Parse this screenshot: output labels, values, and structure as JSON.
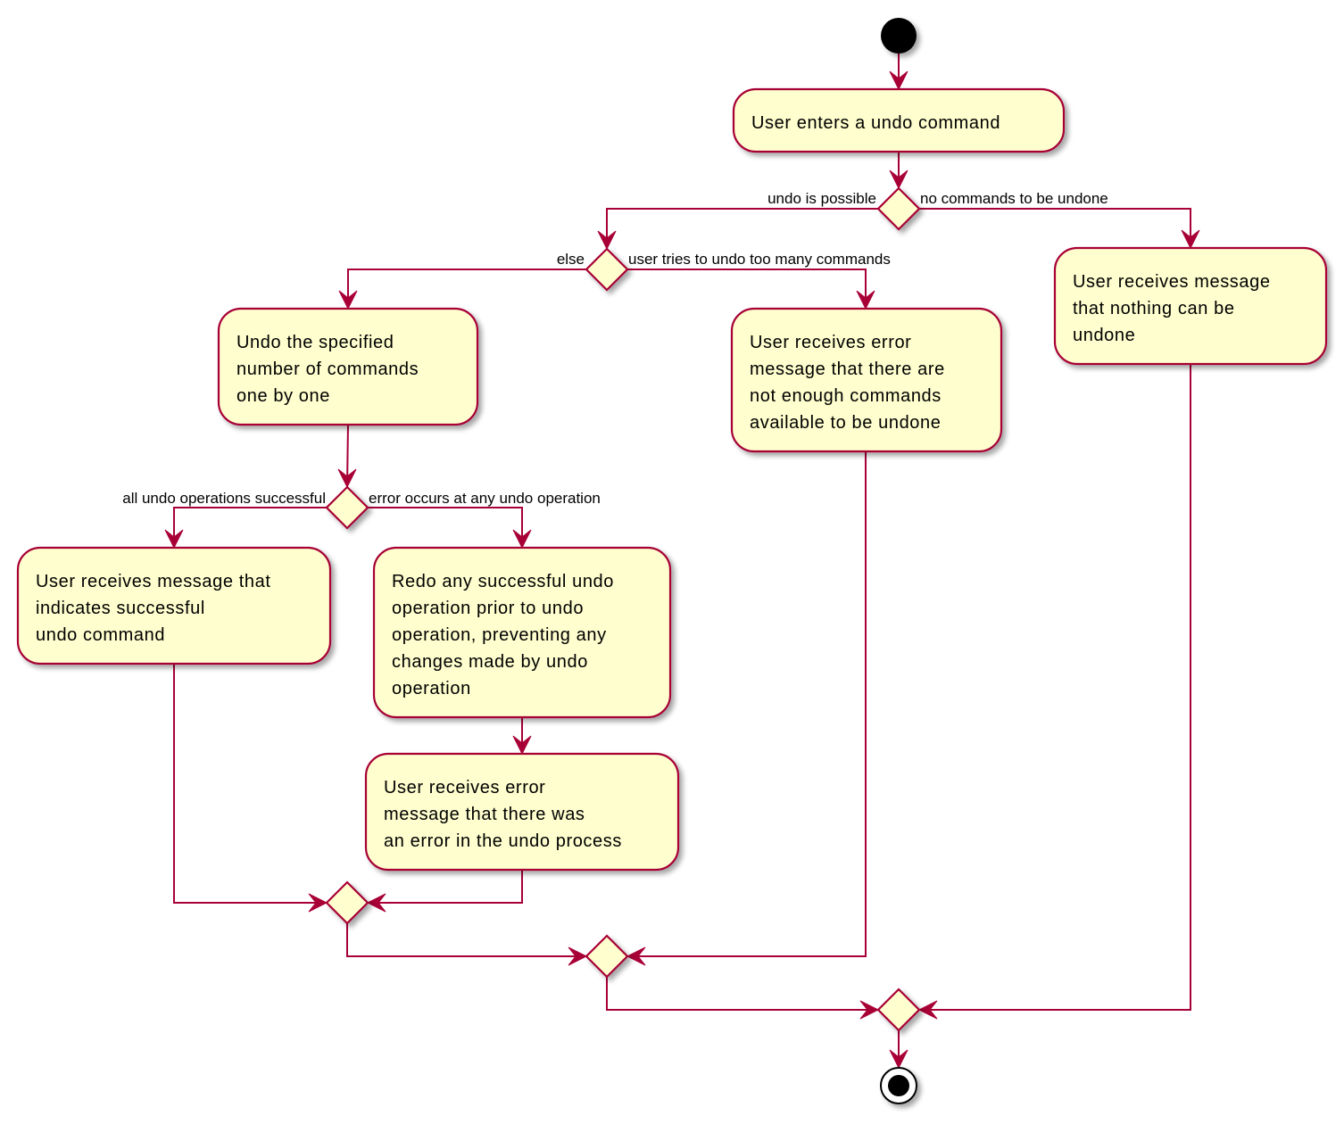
{
  "diagram": {
    "type": "UML activity diagram",
    "colors": {
      "line": "#A80036",
      "fill": "#FEFECE",
      "start": "#000000"
    },
    "nodes": {
      "start": {
        "kind": "start"
      },
      "enter_undo": {
        "kind": "activity",
        "lines": [
          "User enters a undo command"
        ]
      },
      "d_possible": {
        "kind": "decision"
      },
      "d_too_many": {
        "kind": "decision"
      },
      "undo_specified": {
        "kind": "activity",
        "lines": [
          "Undo the specified",
          "number of commands",
          "one by one"
        ]
      },
      "not_enough": {
        "kind": "activity",
        "lines": [
          "User receives error",
          "message that there are",
          "not enough commands",
          "available to be undone"
        ]
      },
      "nothing_undone": {
        "kind": "activity",
        "lines": [
          "User receives message",
          "that nothing can be",
          "undone"
        ]
      },
      "d_success": {
        "kind": "decision"
      },
      "msg_success": {
        "kind": "activity",
        "lines": [
          "User receives message that",
          "indicates successful",
          "undo command"
        ]
      },
      "redo": {
        "kind": "activity",
        "lines": [
          "Redo any successful undo",
          "operation prior to undo",
          "operation, preventing any",
          "changes made by undo",
          "operation"
        ]
      },
      "msg_error": {
        "kind": "activity",
        "lines": [
          "User receives error",
          "message that there was",
          "an error in the undo process"
        ]
      },
      "merge_inner": {
        "kind": "merge"
      },
      "merge_middle": {
        "kind": "merge"
      },
      "merge_outer": {
        "kind": "merge"
      },
      "end": {
        "kind": "end"
      }
    },
    "labels": {
      "undo_possible": "undo is possible",
      "no_commands": "no commands to be undone",
      "else": "else",
      "too_many": "user tries to undo too many commands",
      "all_success": "all undo operations successful",
      "error_any": "error occurs at any undo operation"
    }
  }
}
